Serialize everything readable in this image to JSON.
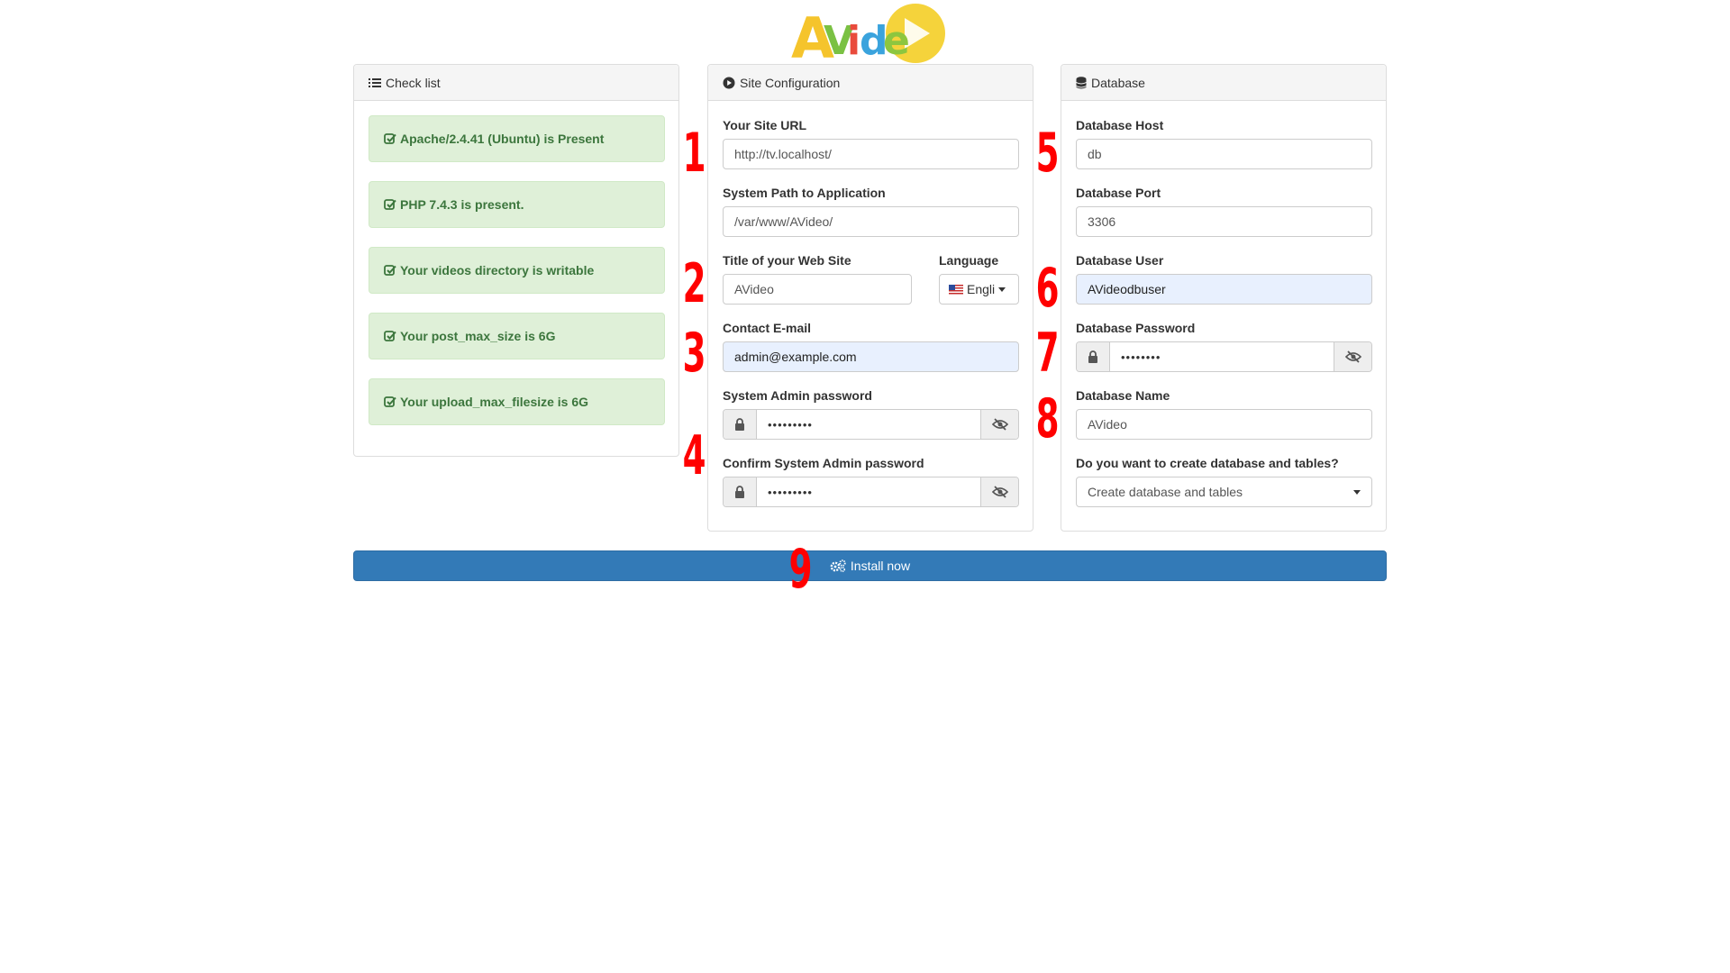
{
  "logo": {
    "text": "AVideo"
  },
  "checklist": {
    "title": "Check list",
    "items": [
      "Apache/2.4.41 (Ubuntu) is Present",
      "PHP 7.4.3 is present.",
      "Your videos directory is writable",
      "Your post_max_size is 6G",
      "Your upload_max_filesize is 6G"
    ]
  },
  "site": {
    "title": "Site Configuration",
    "url_label": "Your Site URL",
    "url_value": "http://tv.localhost/",
    "path_label": "System Path to Application",
    "path_value": "/var/www/AVideo/",
    "webtitle_label": "Title of your Web Site",
    "webtitle_value": "AVideo",
    "language_label": "Language",
    "language_value": "Engli",
    "email_label": "Contact E-mail",
    "email_value": "admin@example.com",
    "admin_pw_label": "System Admin password",
    "admin_pw_value": "•••••••••",
    "confirm_pw_label": "Confirm System Admin password",
    "confirm_pw_value": "•••••••••"
  },
  "database": {
    "title": "Database",
    "host_label": "Database Host",
    "host_value": "db",
    "port_label": "Database Port",
    "port_value": "3306",
    "user_label": "Database User",
    "user_value": "AVideodbuser",
    "pw_label": "Database Password",
    "pw_value": "••••••••",
    "name_label": "Database Name",
    "name_value": "AVideo",
    "create_label": "Do you want to create database and tables?",
    "create_value": "Create database and tables"
  },
  "install_label": "Install now",
  "markers": [
    "1",
    "2",
    "3",
    "4",
    "5",
    "6",
    "7",
    "8",
    "9"
  ],
  "colors": {
    "primary": "#337ab7",
    "success_bg": "#dff0d8",
    "success_text": "#3c763d",
    "marker": "#ff0000"
  }
}
